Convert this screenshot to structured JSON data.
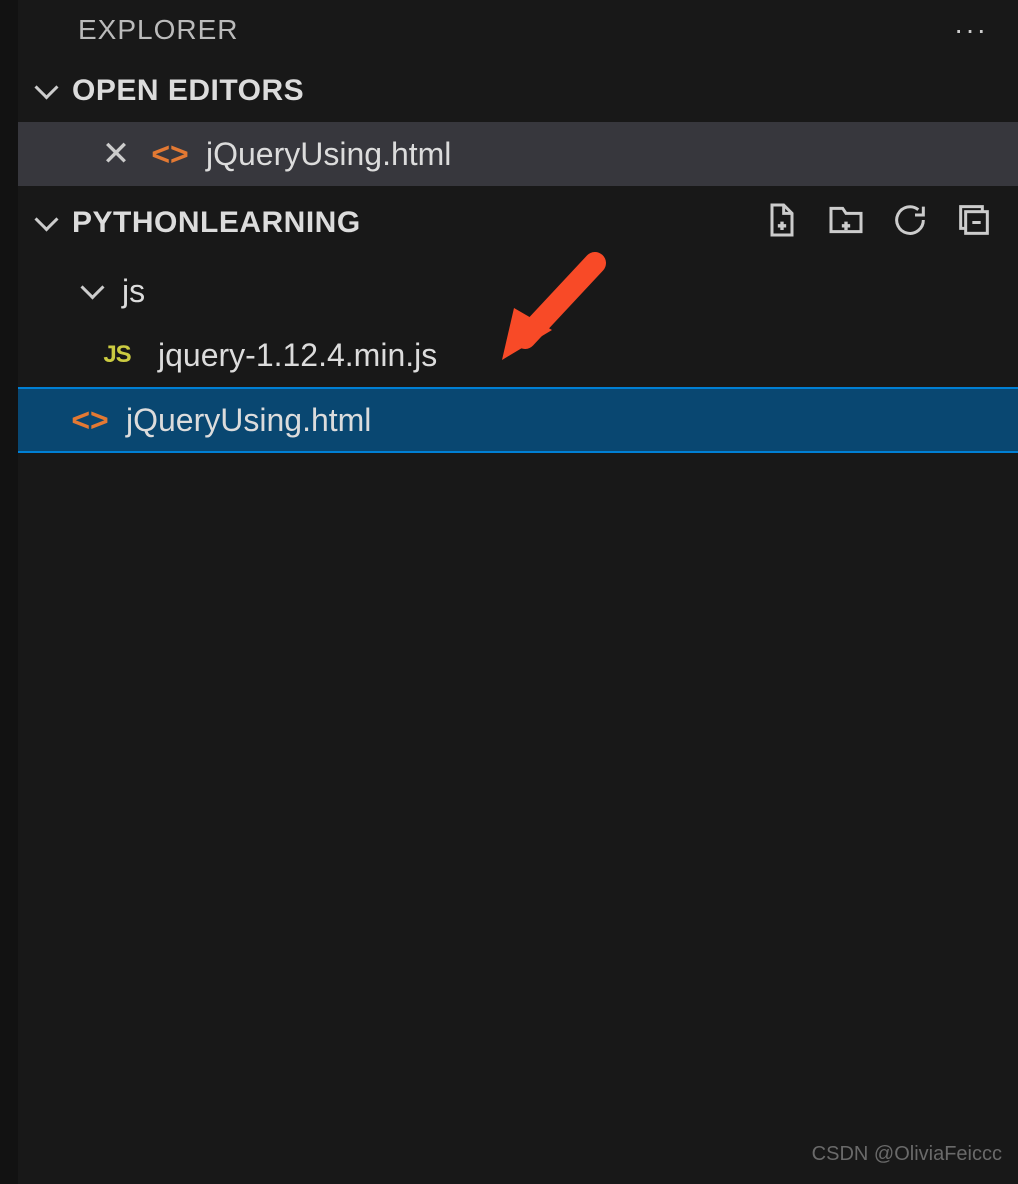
{
  "explorer": {
    "title": "EXPLORER"
  },
  "open_editors": {
    "title": "OPEN EDITORS",
    "items": [
      {
        "name": "jQueryUsing.html",
        "type": "html"
      }
    ]
  },
  "workspace": {
    "title": "PYTHONLEARNING",
    "folders": [
      {
        "name": "js"
      }
    ],
    "files": [
      {
        "name": "jquery-1.12.4.min.js",
        "type": "js",
        "icon_label": "JS"
      },
      {
        "name": "jQueryUsing.html",
        "type": "html"
      }
    ]
  },
  "watermark": "CSDN @OliviaFeiccc"
}
